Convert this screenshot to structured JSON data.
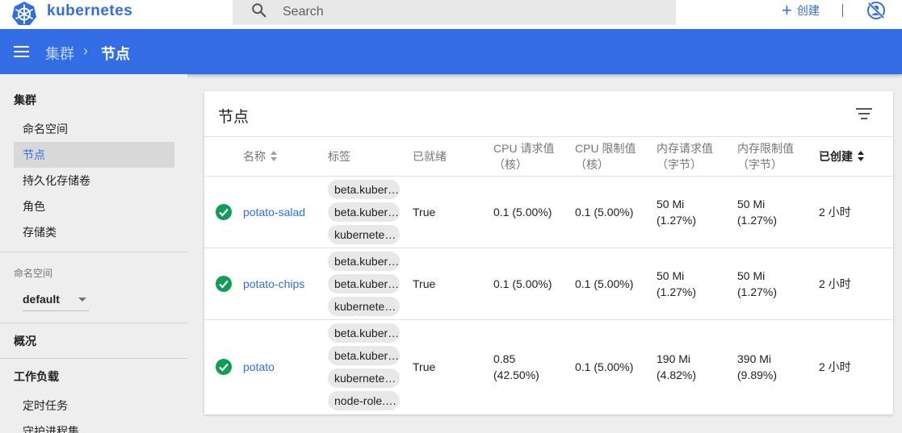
{
  "topbar": {
    "brand": "kubernetes",
    "search_placeholder": "Search",
    "create_label": "创建"
  },
  "header": {
    "breadcrumb_root": "集群",
    "breadcrumb_sep": "›",
    "breadcrumb_current": "节点"
  },
  "sidebar": {
    "cluster_heading": "集群",
    "cluster_items": [
      "命名空间",
      "节点",
      "持久化存储卷",
      "角色",
      "存储类"
    ],
    "active_item": "节点",
    "namespace_label": "命名空间",
    "namespace_value": "default",
    "overview": "概况",
    "workloads_heading": "工作负载",
    "workload_items": [
      "定时任务",
      "守护进程集"
    ]
  },
  "card": {
    "title": "节点",
    "columns": {
      "name": "名称",
      "labels": "标签",
      "ready": "已就绪",
      "cpu_req_1": "CPU 请求值",
      "cpu_req_2": "（核）",
      "cpu_lim_1": "CPU 限制值",
      "cpu_lim_2": "（核）",
      "mem_req_1": "内存请求值",
      "mem_req_2": "（字节）",
      "mem_lim_1": "内存限制值",
      "mem_lim_2": "（字节）",
      "created": "已创建"
    },
    "rows": [
      {
        "name": "potato-salad",
        "labels": [
          "beta.kubernetes.io/arch",
          "beta.kubernetes.io/os",
          "kubernetes.io/hostname"
        ],
        "ready": "True",
        "cpu_req_1": "0.1 (5.00%)",
        "cpu_req_2": "",
        "cpu_lim": "0.1 (5.00%)",
        "mem_req_1": "50 Mi",
        "mem_req_2": "(1.27%)",
        "mem_lim_1": "50 Mi",
        "mem_lim_2": "(1.27%)",
        "created": "2 小时"
      },
      {
        "name": "potato-chips",
        "labels": [
          "beta.kubernetes.io/arch",
          "beta.kubernetes.io/os",
          "kubernetes.io/hostname"
        ],
        "ready": "True",
        "cpu_req_1": "0.1 (5.00%)",
        "cpu_req_2": "",
        "cpu_lim": "0.1 (5.00%)",
        "mem_req_1": "50 Mi",
        "mem_req_2": "(1.27%)",
        "mem_lim_1": "50 Mi",
        "mem_lim_2": "(1.27%)",
        "created": "2 小时"
      },
      {
        "name": "potato",
        "labels": [
          "beta.kubernetes.io/arch",
          "beta.kubernetes.io/os",
          "kubernetes.io/hostname",
          "node-role.kubernetes.io/master"
        ],
        "ready": "True",
        "cpu_req_1": "0.85",
        "cpu_req_2": "(42.50%)",
        "cpu_lim": "0.1 (5.00%)",
        "mem_req_1": "190 Mi",
        "mem_req_2": "(4.82%)",
        "mem_lim_1": "390 Mi",
        "mem_lim_2": "(9.89%)",
        "created": "2 小时"
      }
    ]
  },
  "colors": {
    "brand_blue": "#326de6",
    "ready_green": "#0f9d58"
  }
}
